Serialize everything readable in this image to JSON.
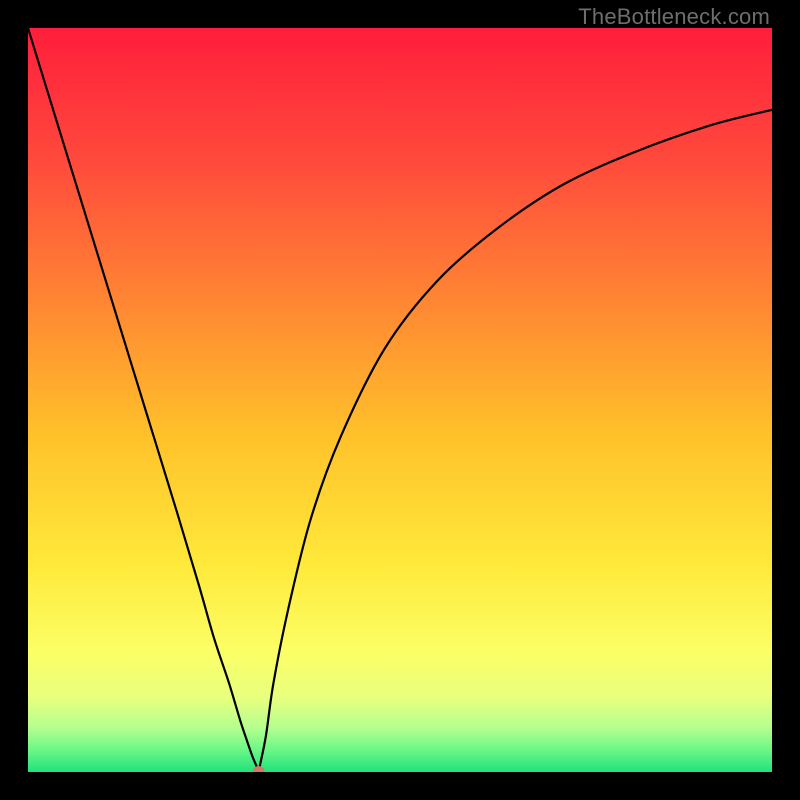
{
  "watermark": "TheBottleneck.com",
  "chart_data": {
    "type": "line",
    "title": "",
    "xlabel": "",
    "ylabel": "",
    "xlim": [
      0,
      100
    ],
    "ylim": [
      0,
      100
    ],
    "grid": false,
    "legend": false,
    "series": [
      {
        "name": "bottleneck-curve",
        "x": [
          0,
          4,
          8,
          12,
          16,
          20,
          23,
          25,
          27,
          28.5,
          29.5,
          30.2,
          30.8,
          31.0,
          31.2,
          32,
          33,
          35,
          38,
          42,
          48,
          55,
          63,
          72,
          82,
          92,
          100
        ],
        "y": [
          100,
          87,
          74,
          61,
          48,
          35,
          25,
          18,
          12,
          7,
          4,
          2,
          0.6,
          0,
          1,
          5,
          12,
          22,
          34,
          45,
          57,
          66,
          73,
          79,
          83.5,
          87,
          89
        ]
      }
    ],
    "markers": [
      {
        "name": "optimal-point",
        "x": 31.0,
        "y": 0
      }
    ],
    "background": {
      "type": "vertical-gradient",
      "description": "red top, yellow middle, green bottom",
      "stops": [
        {
          "offset": 0.0,
          "color": "#ff1e3c"
        },
        {
          "offset": 0.18,
          "color": "#ff4a3c"
        },
        {
          "offset": 0.38,
          "color": "#ff8a32"
        },
        {
          "offset": 0.55,
          "color": "#ffc22a"
        },
        {
          "offset": 0.72,
          "color": "#ffe93a"
        },
        {
          "offset": 0.84,
          "color": "#fbff66"
        },
        {
          "offset": 0.9,
          "color": "#e8ff7e"
        },
        {
          "offset": 0.94,
          "color": "#b5ff8e"
        },
        {
          "offset": 0.97,
          "color": "#6cf787"
        },
        {
          "offset": 1.0,
          "color": "#20e27c"
        }
      ]
    },
    "marker_color": "#cf7a62",
    "curve_color": "#000000"
  }
}
